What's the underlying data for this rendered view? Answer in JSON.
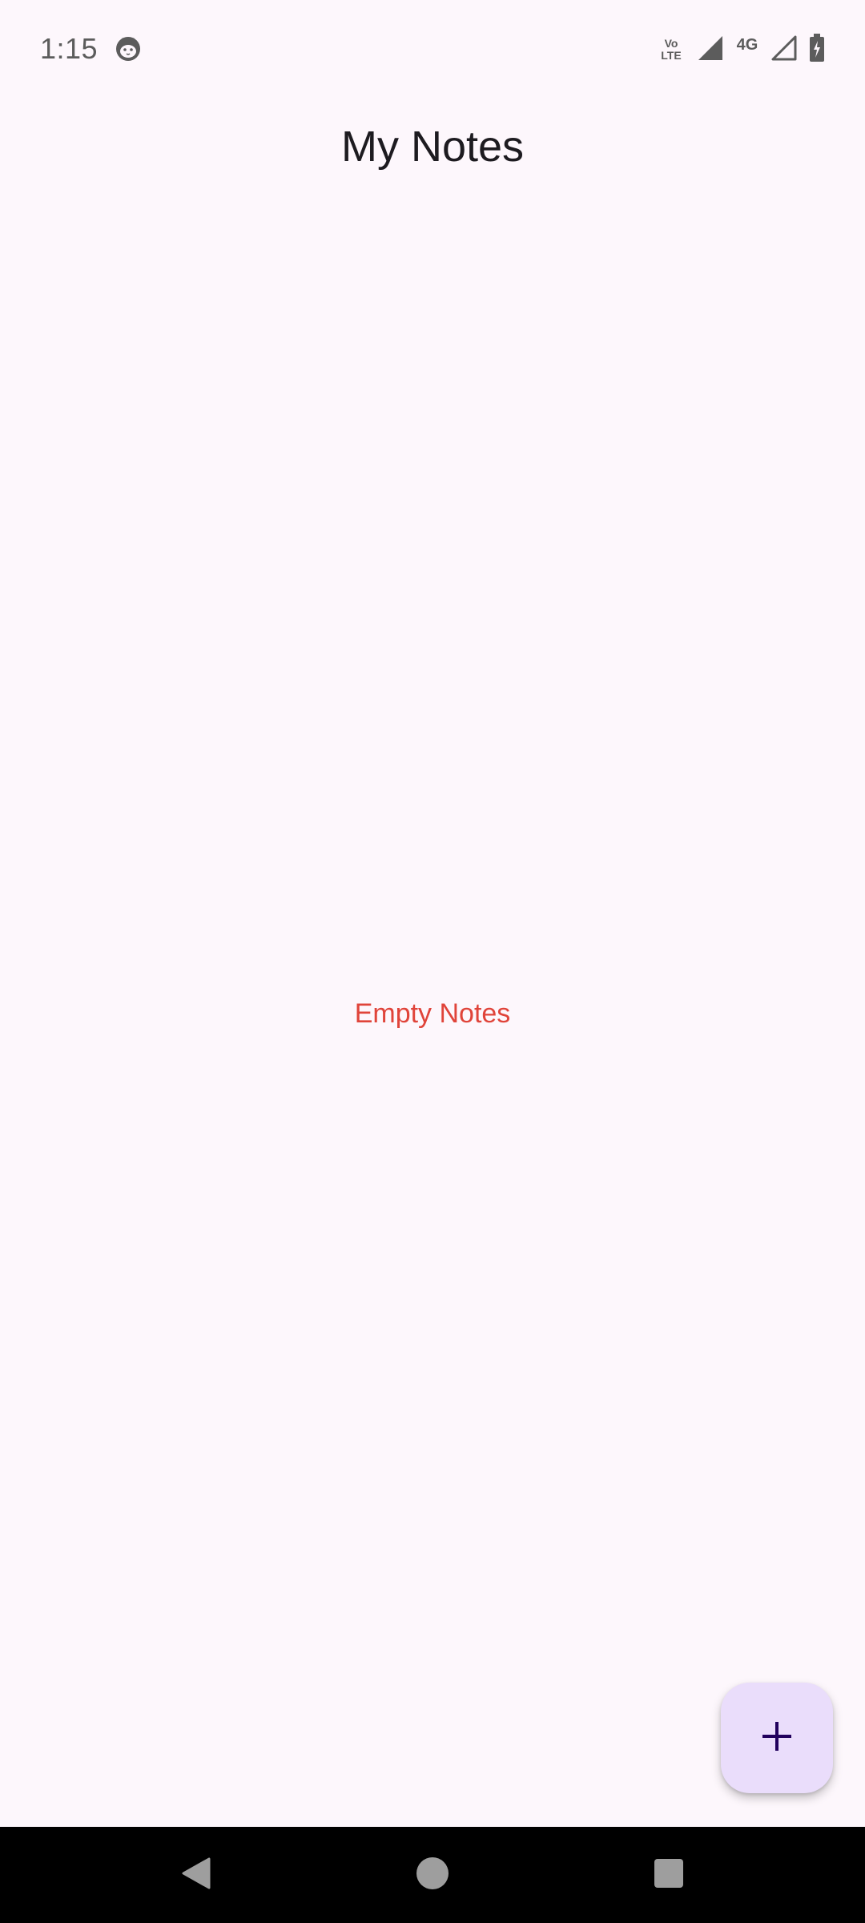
{
  "status_bar": {
    "time": "1:15",
    "volte_top": "Vo",
    "volte_bottom": "LTE",
    "network": "4G",
    "icons": [
      "cat-face-icon",
      "volte-icon",
      "signal-icon",
      "4g-icon",
      "signal-empty-icon",
      "battery-charging-icon"
    ]
  },
  "header": {
    "title": "My Notes"
  },
  "main": {
    "empty_message": "Empty Notes"
  },
  "fab": {
    "icon": "plus-icon"
  },
  "nav": {
    "icons": [
      "back-icon",
      "home-icon",
      "recents-icon"
    ]
  },
  "colors": {
    "background": "#FDF7FC",
    "title": "#1D1B20",
    "empty_message": "#E0443A",
    "fab_background": "#EADDFB",
    "fab_icon": "#21005D",
    "nav_background": "#000000"
  }
}
